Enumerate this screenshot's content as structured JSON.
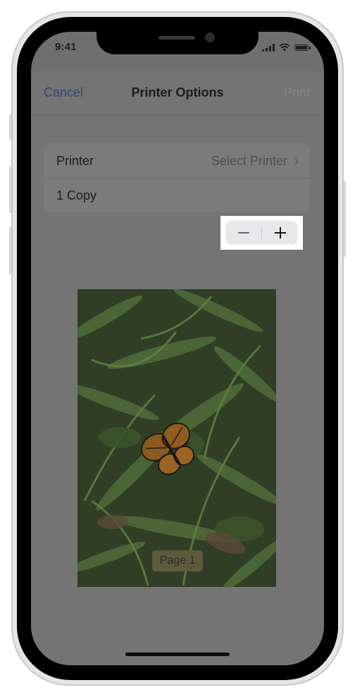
{
  "status_bar": {
    "time": "9:41"
  },
  "nav": {
    "cancel_label": "Cancel",
    "title": "Printer Options",
    "print_label": "Print"
  },
  "options": {
    "printer_label": "Printer",
    "printer_value": "Select Printer",
    "copies_label": "1 Copy",
    "copies_count": 1
  },
  "preview": {
    "page_label": "Page 1"
  },
  "icons": {
    "stepper_decrement": "minus-icon",
    "stepper_increment": "plus-icon",
    "disclosure": "chevron-right-icon"
  },
  "colors": {
    "accent": "#2a4a78",
    "highlight": "#ffffff"
  }
}
